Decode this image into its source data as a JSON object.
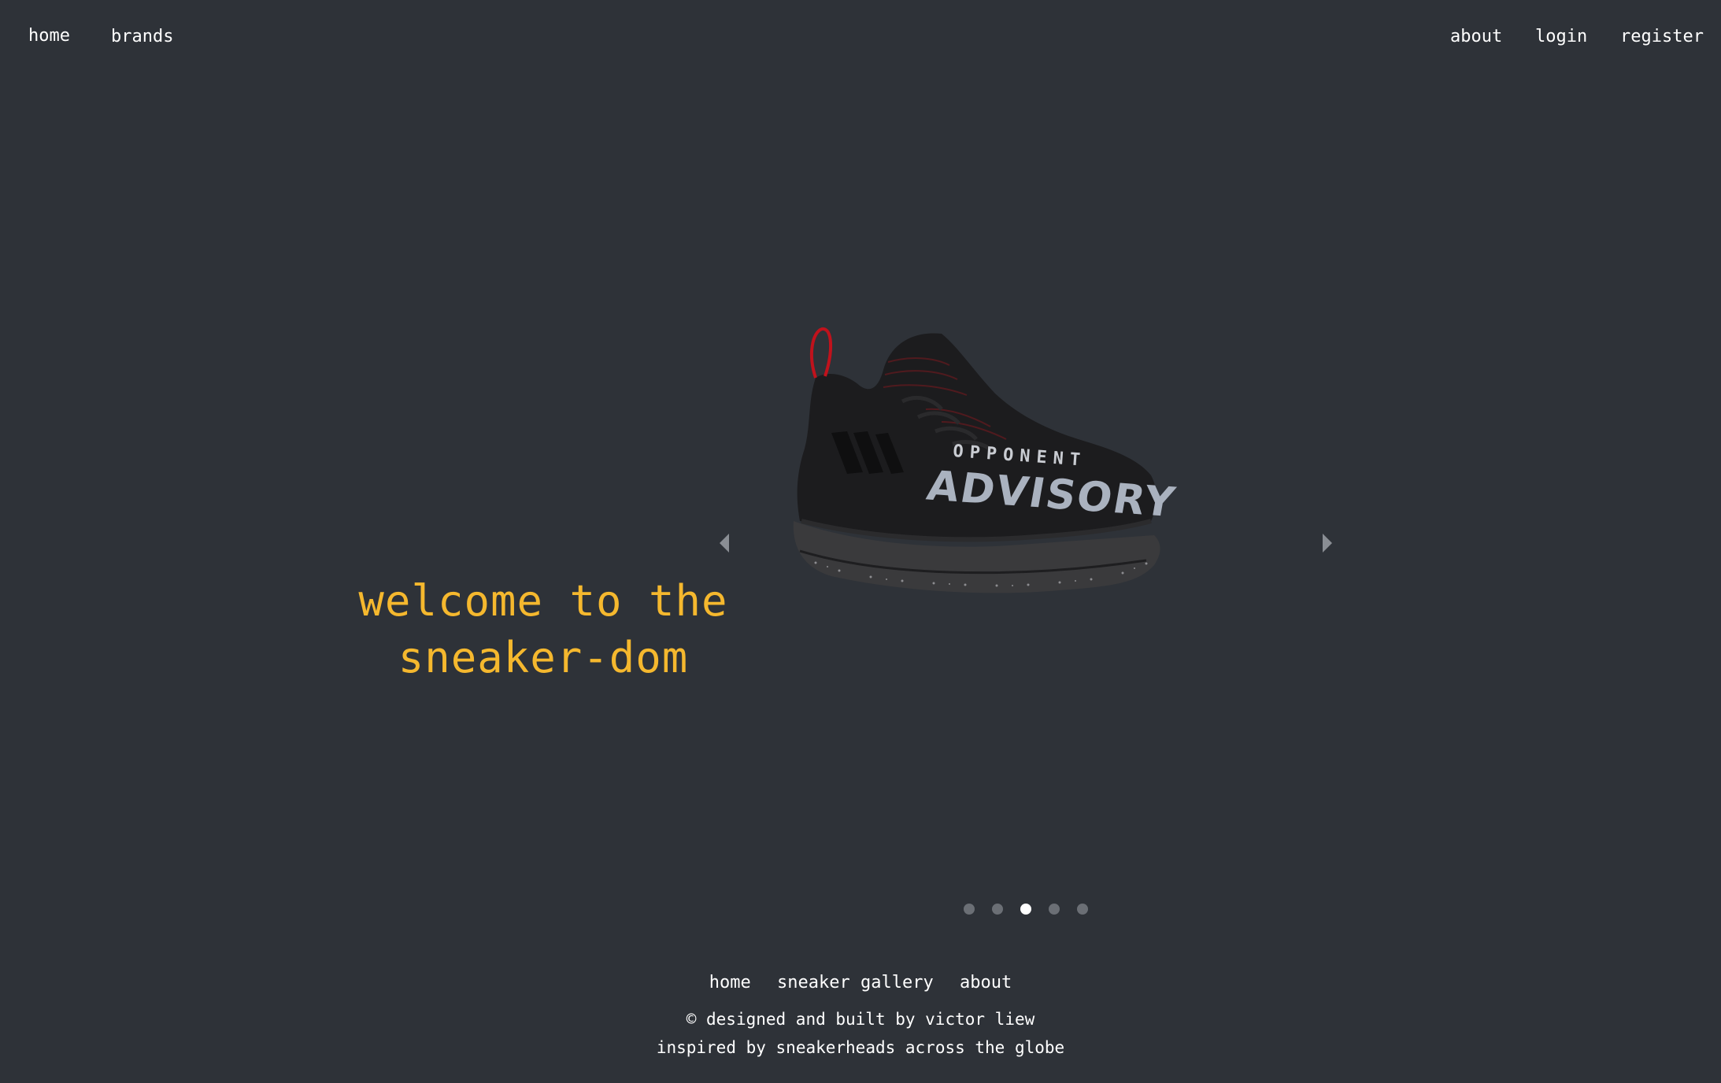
{
  "nav": {
    "left": [
      {
        "label": "home"
      },
      {
        "label": "brands"
      }
    ],
    "right": [
      {
        "label": "about"
      },
      {
        "label": "login"
      },
      {
        "label": "register"
      }
    ]
  },
  "hero": {
    "title_line1": "welcome to the",
    "title_line2": "sneaker-dom",
    "title_color": "#f5b82e"
  },
  "carousel": {
    "slide": {
      "image_icon": "sneaker-image",
      "print_small": "OPPONENT",
      "print_large": "ADVISORY"
    },
    "prev_icon": "chevron-left-icon",
    "next_icon": "chevron-right-icon",
    "slide_count": 5,
    "active_index": 2
  },
  "footer": {
    "links": [
      {
        "label": "home"
      },
      {
        "label": "sneaker gallery"
      },
      {
        "label": "about"
      }
    ],
    "credit": "© designed and built by victor liew",
    "tagline": "inspired by sneakerheads across the globe"
  },
  "colors": {
    "background": "#2e3238",
    "accent": "#f5b82e",
    "dot_inactive": "#6b6f75",
    "dot_active": "#ffffff"
  }
}
